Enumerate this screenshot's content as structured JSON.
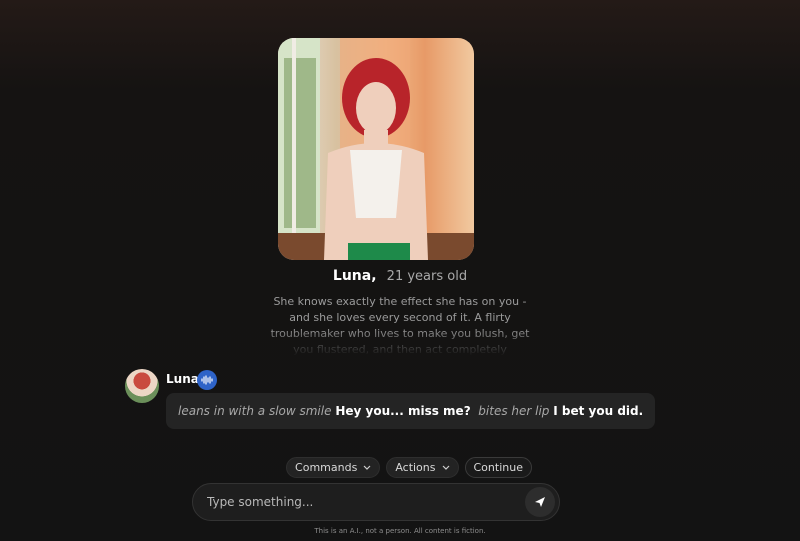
{
  "character": {
    "name": "Luna,",
    "age": "21 years old",
    "bio": "She knows exactly the effect she has on you - and she loves every second of it. A flirty troublemaker who lives to make you blush, get you flustered, and then act completely"
  },
  "message": {
    "author": "Luna",
    "voice_icon": "sound-wave-icon",
    "segments": {
      "action1": "leans in with a slow smile",
      "speech1": "Hey you... miss me?",
      "action2": "bites her lip",
      "speech2": "I bet you did."
    }
  },
  "chips": {
    "commands": "Commands",
    "actions": "Actions",
    "continue": "Continue"
  },
  "composer": {
    "placeholder": "Type something...",
    "send_icon": "send-icon"
  },
  "disclaimer": "This is an A.I., not a person. All content is fiction.",
  "colors": {
    "background": "#131313",
    "bubble": "#242424",
    "voice_badge": "#2e63c8",
    "chip": "#232323"
  }
}
